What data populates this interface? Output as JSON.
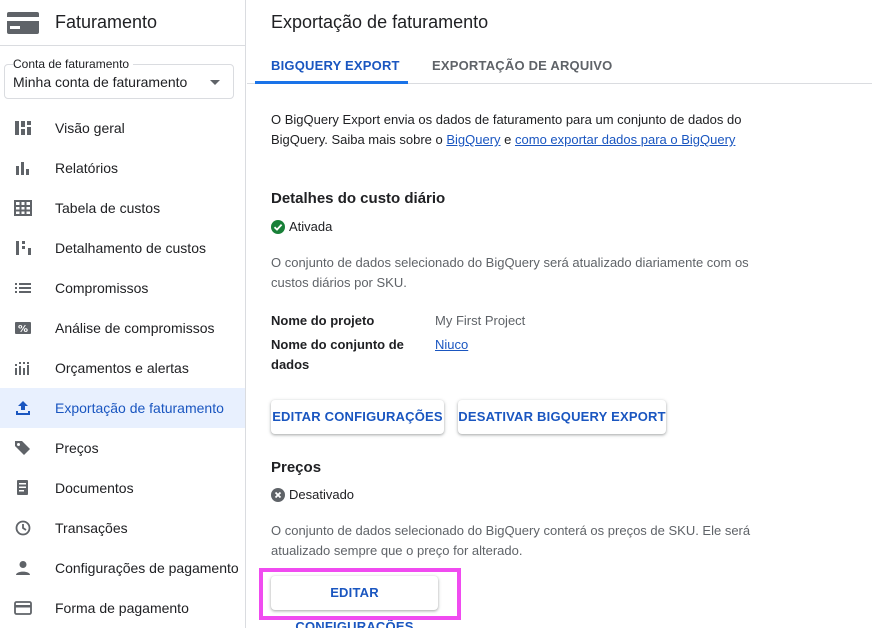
{
  "sidebar": {
    "title": "Faturamento",
    "account": {
      "label": "Conta de faturamento",
      "value": "Minha conta de faturamento"
    },
    "items": [
      {
        "label": "Visão geral",
        "icon": "dashboard-icon"
      },
      {
        "label": "Relatórios",
        "icon": "bar-chart-icon"
      },
      {
        "label": "Tabela de custos",
        "icon": "table-icon"
      },
      {
        "label": "Detalhamento de custos",
        "icon": "breakdown-icon"
      },
      {
        "label": "Compromissos",
        "icon": "list-icon"
      },
      {
        "label": "Análise de compromissos",
        "icon": "percent-icon"
      },
      {
        "label": "Orçamentos e alertas",
        "icon": "budget-icon"
      },
      {
        "label": "Exportação de faturamento",
        "icon": "upload-icon",
        "active": true
      },
      {
        "label": "Preços",
        "icon": "tag-icon"
      },
      {
        "label": "Documentos",
        "icon": "document-icon"
      },
      {
        "label": "Transações",
        "icon": "clock-icon"
      },
      {
        "label": "Configurações de pagamento",
        "icon": "person-icon"
      },
      {
        "label": "Forma de pagamento",
        "icon": "credit-card-icon"
      }
    ]
  },
  "main": {
    "title": "Exportação de faturamento",
    "tabs": [
      {
        "label": "BIGQUERY EXPORT",
        "active": true
      },
      {
        "label": "EXPORTAÇÃO DE ARQUIVO",
        "active": false
      }
    ],
    "intro": {
      "text_before": "O BigQuery Export envia os dados de faturamento para um conjunto de dados do BigQuery. Saiba mais sobre o ",
      "link1": "BigQuery",
      "text_mid": " e ",
      "link2": "como exportar dados para o BigQuery"
    },
    "daily": {
      "heading": "Detalhes do custo diário",
      "status": "Ativada",
      "description": "O conjunto de dados selecionado do BigQuery será atualizado diariamente com os custos diários por SKU.",
      "project_key": "Nome do projeto",
      "project_value": "My First Project",
      "dataset_key": "Nome do conjunto de dados",
      "dataset_value": "Niuco",
      "edit_button": "EDITAR CONFIGURAÇÕES",
      "disable_button": "DESATIVAR BIGQUERY EXPORT"
    },
    "pricing": {
      "heading": "Preços",
      "status": "Desativado",
      "description": "O conjunto de dados selecionado do BigQuery conterá os preços de SKU. Ele será atualizado sempre que o preço for alterado.",
      "edit_button": "EDITAR CONFIGURAÇÕES"
    }
  },
  "colors": {
    "accent": "#1a56c0",
    "active_bg": "#e8f0fe",
    "enabled": "#188038",
    "highlight": "#f04bf0"
  }
}
